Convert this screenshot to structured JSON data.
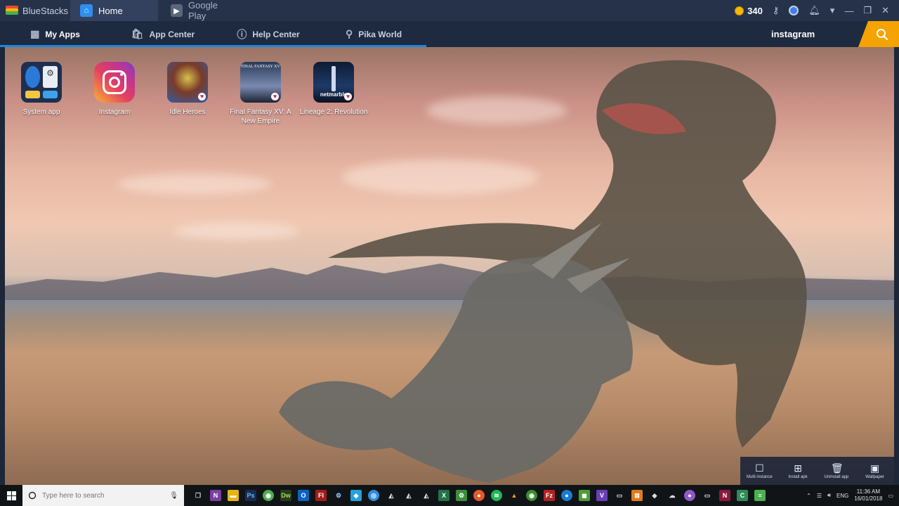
{
  "titlebar": {
    "brand": "BlueStacks",
    "tabs": [
      {
        "label": "Home",
        "icon": "home-icon"
      },
      {
        "label": "Google Play",
        "icon": "google-play-icon"
      }
    ],
    "points": "340",
    "icons": [
      "coin-icon",
      "key-icon",
      "account-icon",
      "bell-icon",
      "menu-icon",
      "minimize-icon",
      "restore-icon",
      "close-icon"
    ]
  },
  "nav": {
    "items": [
      {
        "label": "My Apps",
        "icon": "grid-icon"
      },
      {
        "label": "App Center",
        "icon": "bag-icon"
      },
      {
        "label": "Help Center",
        "icon": "help-icon"
      },
      {
        "label": "Pika World",
        "icon": "pin-icon"
      }
    ],
    "search_value": "instagram",
    "accent": "#1c86e0",
    "search_color": "#f5a300"
  },
  "apps": [
    {
      "label": "System app"
    },
    {
      "label": "Instagram"
    },
    {
      "label": "Idle Heroes"
    },
    {
      "label": "Final Fantasy XV: A New Empire"
    },
    {
      "label": "Lineage 2: Revolution"
    }
  ],
  "app_icon_text": {
    "ffxv": "FINAL FANTASY XV",
    "lineage": "netmarble"
  },
  "toolbox": [
    {
      "label": "Multi instance",
      "icon": "multi-instance-icon"
    },
    {
      "label": "Install apk",
      "icon": "install-apk-icon"
    },
    {
      "label": "Uninstall app",
      "icon": "uninstall-icon"
    },
    {
      "label": "Wallpaper",
      "icon": "wallpaper-icon"
    }
  ],
  "taskbar": {
    "search_placeholder": "Type here to search",
    "language": "ENG",
    "time": "11:36 AM",
    "date": "16/01/2018"
  }
}
